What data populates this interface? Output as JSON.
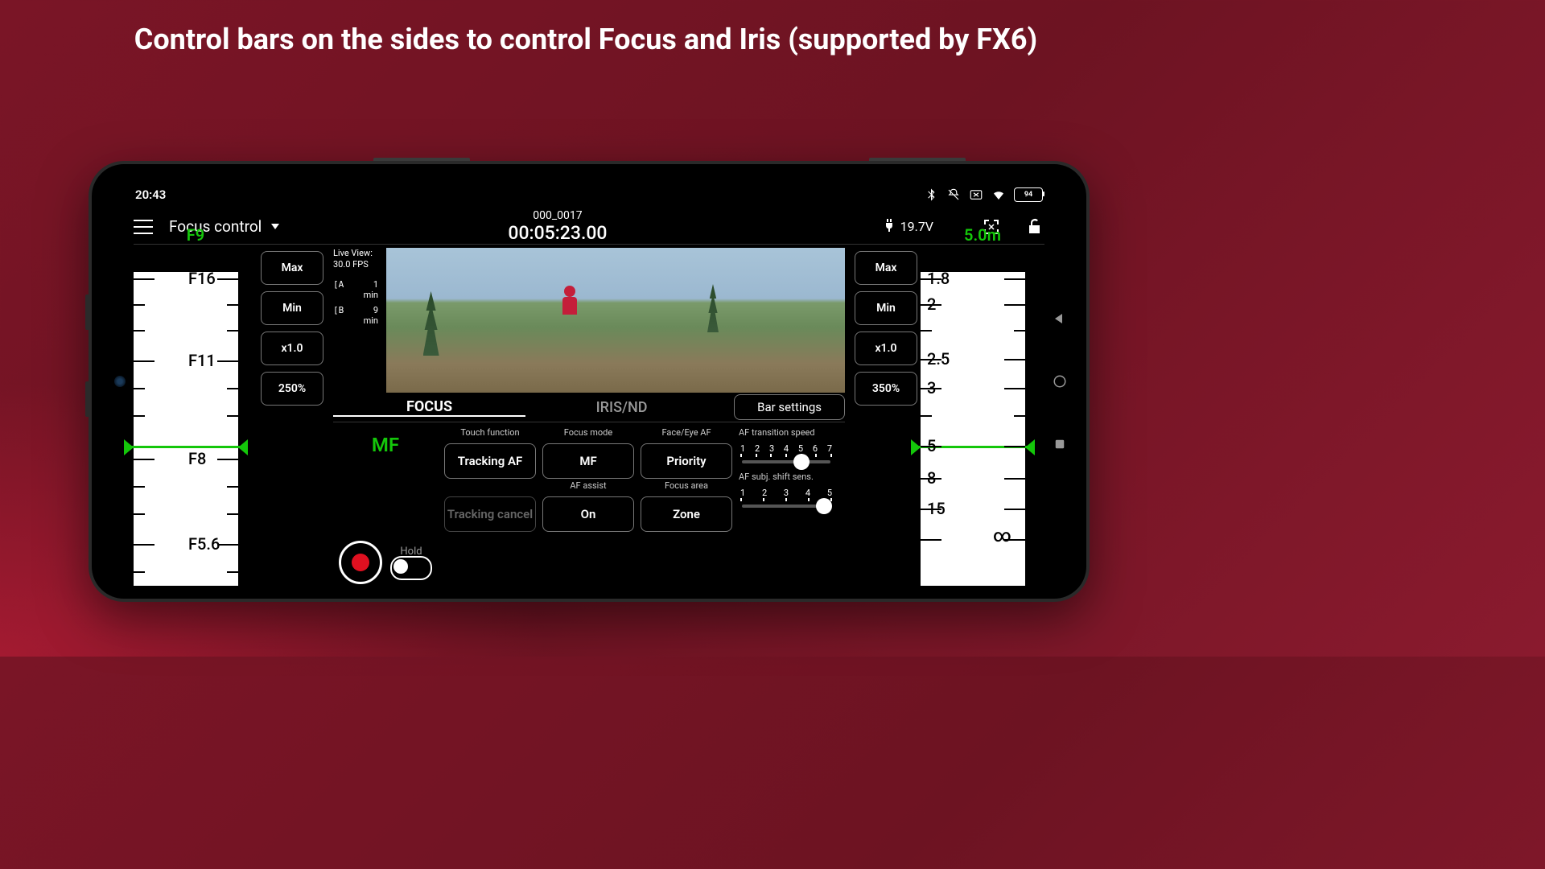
{
  "title": "Control bars on the sides to control Focus and Iris (supported by FX6)",
  "status": {
    "time": "20:43",
    "battery": "94"
  },
  "topbar": {
    "mode": "Focus control",
    "clip_name": "000_0017",
    "timecode": "00:05:23.00",
    "voltage": "19.7V"
  },
  "iris_scale": {
    "label": "F9",
    "marks": [
      "F16",
      "F11",
      "F8",
      "F5.6"
    ]
  },
  "focus_scale": {
    "label": "5.0m",
    "marks": [
      "1.8",
      "2",
      "2.5",
      "3",
      "5",
      "8",
      "15",
      "∞"
    ]
  },
  "side_buttons": {
    "max": "Max",
    "min": "Min",
    "x1": "x1.0",
    "pct_left": "250%",
    "pct_right": "350%"
  },
  "liveview": {
    "label": "Live View:",
    "fps": "30.0 FPS",
    "a": "A",
    "a_val": "1",
    "a_unit": "min",
    "b": "B",
    "b_val": "9",
    "b_unit": "min"
  },
  "tabs": {
    "focus": "FOCUS",
    "iris": "IRIS/ND"
  },
  "bar_settings": "Bar settings",
  "mf": "MF",
  "hold": "Hold",
  "ctrl": {
    "touch_hdr": "Touch function",
    "touch_btn": "Tracking AF",
    "mode_hdr": "Focus mode",
    "mode_btn": "MF",
    "face_hdr": "Face/Eye AF",
    "face_btn": "Priority",
    "track_cancel": "Tracking cancel",
    "assist_hdr": "AF assist",
    "assist_btn": "On",
    "area_hdr": "Focus area",
    "area_btn": "Zone"
  },
  "sliders": {
    "trans_hdr": "AF transition speed",
    "trans_scale": [
      "1",
      "2",
      "3",
      "4",
      "5",
      "6",
      "7"
    ],
    "trans_val": 5,
    "sens_hdr": "AF subj. shift sens.",
    "sens_scale": [
      "1",
      "2",
      "3",
      "4",
      "5"
    ],
    "sens_val": 5
  }
}
